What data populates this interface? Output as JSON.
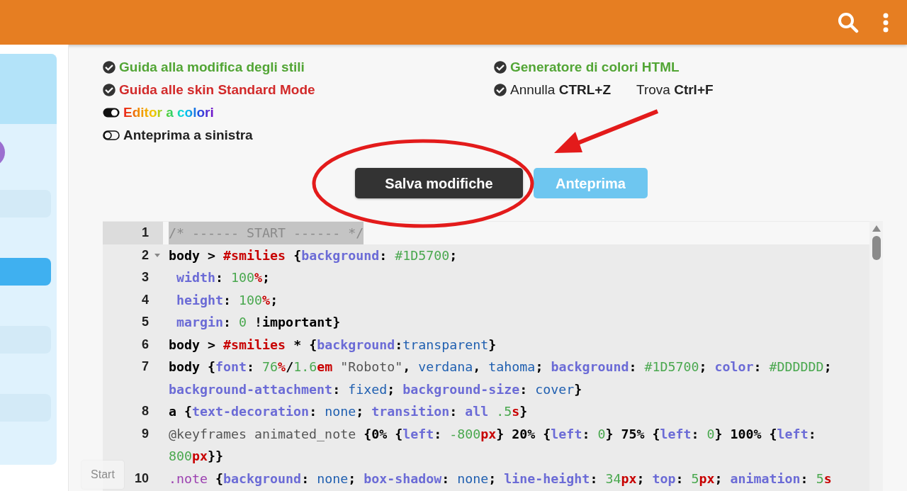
{
  "sidebar": {
    "items": [
      {
        "selected": false
      },
      {
        "selected": true
      },
      {
        "selected": false
      },
      {
        "selected": false
      }
    ]
  },
  "left_options": [
    {
      "kind": "link",
      "text": "Guida alla modifica degli stili",
      "color": "#52a535"
    },
    {
      "kind": "link",
      "text": "Guida alle skin Standard Mode",
      "color": "#d22a2a"
    },
    {
      "kind": "toggle",
      "text": "Editor a colori",
      "on": true,
      "rainbow": true
    },
    {
      "kind": "toggle",
      "text": "Anteprima a sinistra",
      "on": false,
      "rainbow": false
    }
  ],
  "right_options": [
    {
      "kind": "link",
      "text": "Generatore di colori HTML",
      "color": "#52a535"
    },
    {
      "kind": "shortcut",
      "text": "Annulla **CTRL+Z**",
      "extra": "Trova **Ctrl+F**"
    }
  ],
  "buttons": [
    {
      "label": "Salva modifiche",
      "kind": "primary"
    },
    {
      "label": "Anteprima",
      "kind": "secondary"
    }
  ],
  "editor": {
    "lines": [
      {
        "number": "1",
        "selected": true,
        "tokens": [
          {
            "text": "/* ------ START ------ */",
            "kind": "comment"
          }
        ]
      },
      {
        "number": "2",
        "selected": false,
        "expanded": true,
        "tokens": [
          {
            "text": "body",
            "kind": "sel"
          },
          {
            "text": " > ",
            "kind": "p"
          },
          {
            "text": "#smilies",
            "kind": "id"
          },
          {
            "text": " {",
            "kind": "p"
          },
          {
            "text": "background",
            "kind": "prop"
          },
          {
            "text": ": ",
            "kind": "p"
          },
          {
            "text": "#1D5700",
            "kind": "num"
          },
          {
            "text": ";",
            "kind": "p"
          }
        ]
      },
      {
        "number": "3",
        "selected": false,
        "tokens": [
          {
            "text": " width",
            "kind": "prop"
          },
          {
            "text": ": ",
            "kind": "p"
          },
          {
            "text": "100",
            "kind": "num"
          },
          {
            "text": "%",
            "kind": "unit"
          },
          {
            "text": ";",
            "kind": "p"
          }
        ]
      },
      {
        "number": "4",
        "selected": false,
        "tokens": [
          {
            "text": " height",
            "kind": "prop"
          },
          {
            "text": ": ",
            "kind": "p"
          },
          {
            "text": "100",
            "kind": "num"
          },
          {
            "text": "%",
            "kind": "unit"
          },
          {
            "text": ";",
            "kind": "p"
          }
        ]
      },
      {
        "number": "5",
        "selected": false,
        "tokens": [
          {
            "text": " margin",
            "kind": "prop"
          },
          {
            "text": ": ",
            "kind": "p"
          },
          {
            "text": "0",
            "kind": "num"
          },
          {
            "text": " !important}",
            "kind": "p"
          }
        ]
      },
      {
        "number": "6",
        "selected": false,
        "tokens": [
          {
            "text": "body",
            "kind": "sel"
          },
          {
            "text": " > ",
            "kind": "p"
          },
          {
            "text": "#smilies",
            "kind": "id"
          },
          {
            "text": " * {",
            "kind": "p"
          },
          {
            "text": "background",
            "kind": "prop"
          },
          {
            "text": ":",
            "kind": "p"
          },
          {
            "text": "transparent",
            "kind": "kw"
          },
          {
            "text": "}",
            "kind": "p"
          }
        ]
      },
      {
        "number": "7",
        "selected": false,
        "tokens": [
          {
            "text": "body",
            "kind": "sel"
          },
          {
            "text": " {",
            "kind": "p"
          },
          {
            "text": "font",
            "kind": "prop"
          },
          {
            "text": ": ",
            "kind": "p"
          },
          {
            "text": "76",
            "kind": "num"
          },
          {
            "text": "%",
            "kind": "unit"
          },
          {
            "text": "/",
            "kind": "p"
          },
          {
            "text": "1.6",
            "kind": "num"
          },
          {
            "text": "em",
            "kind": "unit"
          },
          {
            "text": " \"Roboto\"",
            "kind": "str"
          },
          {
            "text": ", ",
            "kind": "p"
          },
          {
            "text": "verdana",
            "kind": "kw"
          },
          {
            "text": ", ",
            "kind": "p"
          },
          {
            "text": "tahoma",
            "kind": "kw"
          },
          {
            "text": "; ",
            "kind": "p"
          },
          {
            "text": "background",
            "kind": "prop"
          },
          {
            "text": ": ",
            "kind": "p"
          },
          {
            "text": "#1D5700",
            "kind": "num"
          },
          {
            "text": "; ",
            "kind": "p"
          },
          {
            "text": "color",
            "kind": "prop"
          },
          {
            "text": ": ",
            "kind": "p"
          },
          {
            "text": "#DDDDDD",
            "kind": "num"
          },
          {
            "text": "; ",
            "kind": "p"
          },
          {
            "text": "background-attachment",
            "kind": "prop"
          },
          {
            "text": ": ",
            "kind": "p"
          },
          {
            "text": "fixed",
            "kind": "kw"
          },
          {
            "text": "; ",
            "kind": "p"
          },
          {
            "text": "background-size",
            "kind": "prop"
          },
          {
            "text": ": ",
            "kind": "p"
          },
          {
            "text": "cover",
            "kind": "kw"
          },
          {
            "text": "}",
            "kind": "p"
          }
        ]
      },
      {
        "number": "8",
        "selected": false,
        "tokens": [
          {
            "text": "a",
            "kind": "sel"
          },
          {
            "text": " {",
            "kind": "p"
          },
          {
            "text": "text-decoration",
            "kind": "prop"
          },
          {
            "text": ": ",
            "kind": "p"
          },
          {
            "text": "none",
            "kind": "kw"
          },
          {
            "text": "; ",
            "kind": "p"
          },
          {
            "text": "transition",
            "kind": "prop"
          },
          {
            "text": ": ",
            "kind": "p"
          },
          {
            "text": "all",
            "kind": "prop"
          },
          {
            "text": " .5",
            "kind": "num"
          },
          {
            "text": "s",
            "kind": "unit"
          },
          {
            "text": "}",
            "kind": "p"
          }
        ]
      },
      {
        "number": "9",
        "selected": false,
        "tokens": [
          {
            "text": "@keyframes animated_note ",
            "kind": "str"
          },
          {
            "text": "{",
            "kind": "p"
          },
          {
            "text": "0%",
            "kind": "sel"
          },
          {
            "text": " {",
            "kind": "p"
          },
          {
            "text": "left",
            "kind": "prop"
          },
          {
            "text": ": ",
            "kind": "p"
          },
          {
            "text": "-800",
            "kind": "num"
          },
          {
            "text": "px",
            "kind": "unit"
          },
          {
            "text": "} ",
            "kind": "p"
          },
          {
            "text": "20%",
            "kind": "sel"
          },
          {
            "text": " {",
            "kind": "p"
          },
          {
            "text": "left",
            "kind": "prop"
          },
          {
            "text": ": ",
            "kind": "p"
          },
          {
            "text": "0",
            "kind": "num"
          },
          {
            "text": "} ",
            "kind": "p"
          },
          {
            "text": "75%",
            "kind": "sel"
          },
          {
            "text": " {",
            "kind": "p"
          },
          {
            "text": "left",
            "kind": "prop"
          },
          {
            "text": ": ",
            "kind": "p"
          },
          {
            "text": "0",
            "kind": "num"
          },
          {
            "text": "} ",
            "kind": "p"
          },
          {
            "text": "100%",
            "kind": "sel"
          },
          {
            "text": " {",
            "kind": "p"
          },
          {
            "text": "left",
            "kind": "prop"
          },
          {
            "text": ": ",
            "kind": "p"
          },
          {
            "text": "800",
            "kind": "num"
          },
          {
            "text": "px",
            "kind": "unit"
          },
          {
            "text": "}}",
            "kind": "p"
          }
        ]
      },
      {
        "number": "10",
        "selected": false,
        "tokens": [
          {
            "text": ".note ",
            "kind": "cls"
          },
          {
            "text": "{",
            "kind": "p"
          },
          {
            "text": "background",
            "kind": "prop"
          },
          {
            "text": ": ",
            "kind": "p"
          },
          {
            "text": "none",
            "kind": "kw"
          },
          {
            "text": "; ",
            "kind": "p"
          },
          {
            "text": "box-shadow",
            "kind": "prop"
          },
          {
            "text": ": ",
            "kind": "p"
          },
          {
            "text": "none",
            "kind": "kw"
          },
          {
            "text": "; ",
            "kind": "p"
          },
          {
            "text": "line-height",
            "kind": "prop"
          },
          {
            "text": ": ",
            "kind": "p"
          },
          {
            "text": "34",
            "kind": "num"
          },
          {
            "text": "px",
            "kind": "unit"
          },
          {
            "text": "; ",
            "kind": "p"
          },
          {
            "text": "top",
            "kind": "prop"
          },
          {
            "text": ": ",
            "kind": "p"
          },
          {
            "text": "5",
            "kind": "num"
          },
          {
            "text": "px",
            "kind": "unit"
          },
          {
            "text": "; ",
            "kind": "p"
          },
          {
            "text": "animation",
            "kind": "prop"
          },
          {
            "text": ": ",
            "kind": "p"
          },
          {
            "text": "5",
            "kind": "num"
          },
          {
            "text": "s",
            "kind": "unit"
          }
        ]
      }
    ]
  },
  "floating_button": "Start"
}
